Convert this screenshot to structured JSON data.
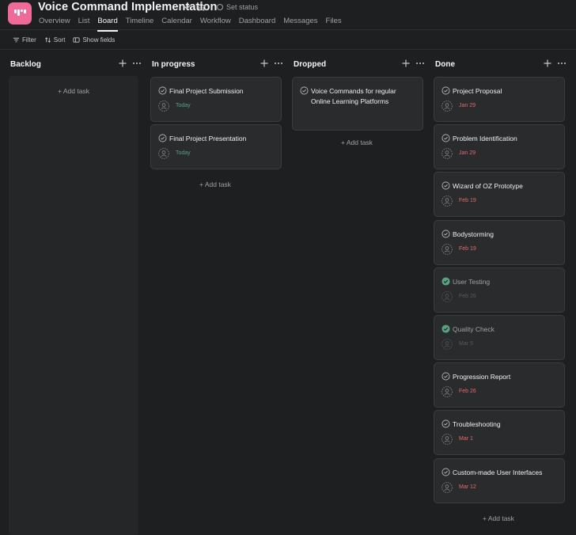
{
  "header": {
    "title": "Voice Command Implementation",
    "set_status": "Set status",
    "tabs": [
      {
        "label": "Overview",
        "active": false
      },
      {
        "label": "List",
        "active": false
      },
      {
        "label": "Board",
        "active": true
      },
      {
        "label": "Timeline",
        "active": false
      },
      {
        "label": "Calendar",
        "active": false
      },
      {
        "label": "Workflow",
        "active": false
      },
      {
        "label": "Dashboard",
        "active": false
      },
      {
        "label": "Messages",
        "active": false
      },
      {
        "label": "Files",
        "active": false
      }
    ]
  },
  "toolbar": {
    "filter": "Filter",
    "sort": "Sort",
    "show_fields": "Show fields"
  },
  "add_task_label": "+ Add task",
  "colors": {
    "accent": "#f06a99",
    "background": "#1e1f21",
    "card": "#2a2b2d",
    "due_today": "#58a182",
    "overdue": "#e36a6a",
    "completed_check": "#58a182"
  },
  "columns": [
    {
      "title": "Backlog",
      "cards": []
    },
    {
      "title": "In progress",
      "cards": [
        {
          "title": "Final Project Submission",
          "date": "Today",
          "completed": false
        },
        {
          "title": "Final Project Presentation",
          "date": "Today",
          "completed": false
        }
      ]
    },
    {
      "title": "Dropped",
      "cards": [
        {
          "title": "Voice Commands for regular Online Learning Platforms",
          "date": "",
          "completed": false
        }
      ]
    },
    {
      "title": "Done",
      "cards": [
        {
          "title": "Project Proposal",
          "date": "Jan 29",
          "completed": false
        },
        {
          "title": "Problem Identification",
          "date": "Jan 29",
          "completed": false
        },
        {
          "title": "Wizard of OZ Prototype",
          "date": "Feb 19",
          "completed": false
        },
        {
          "title": "Bodystorming",
          "date": "Feb 19",
          "completed": false
        },
        {
          "title": "User Testing",
          "date": "Feb 26",
          "completed": true
        },
        {
          "title": "Quality Check",
          "date": "Mar 5",
          "completed": true
        },
        {
          "title": "Progression Report",
          "date": "Feb 26",
          "completed": false
        },
        {
          "title": "Troubleshooting",
          "date": "Mar 1",
          "completed": false
        },
        {
          "title": "Custom-made User Interfaces",
          "date": "Mar 12",
          "completed": false
        }
      ]
    }
  ]
}
